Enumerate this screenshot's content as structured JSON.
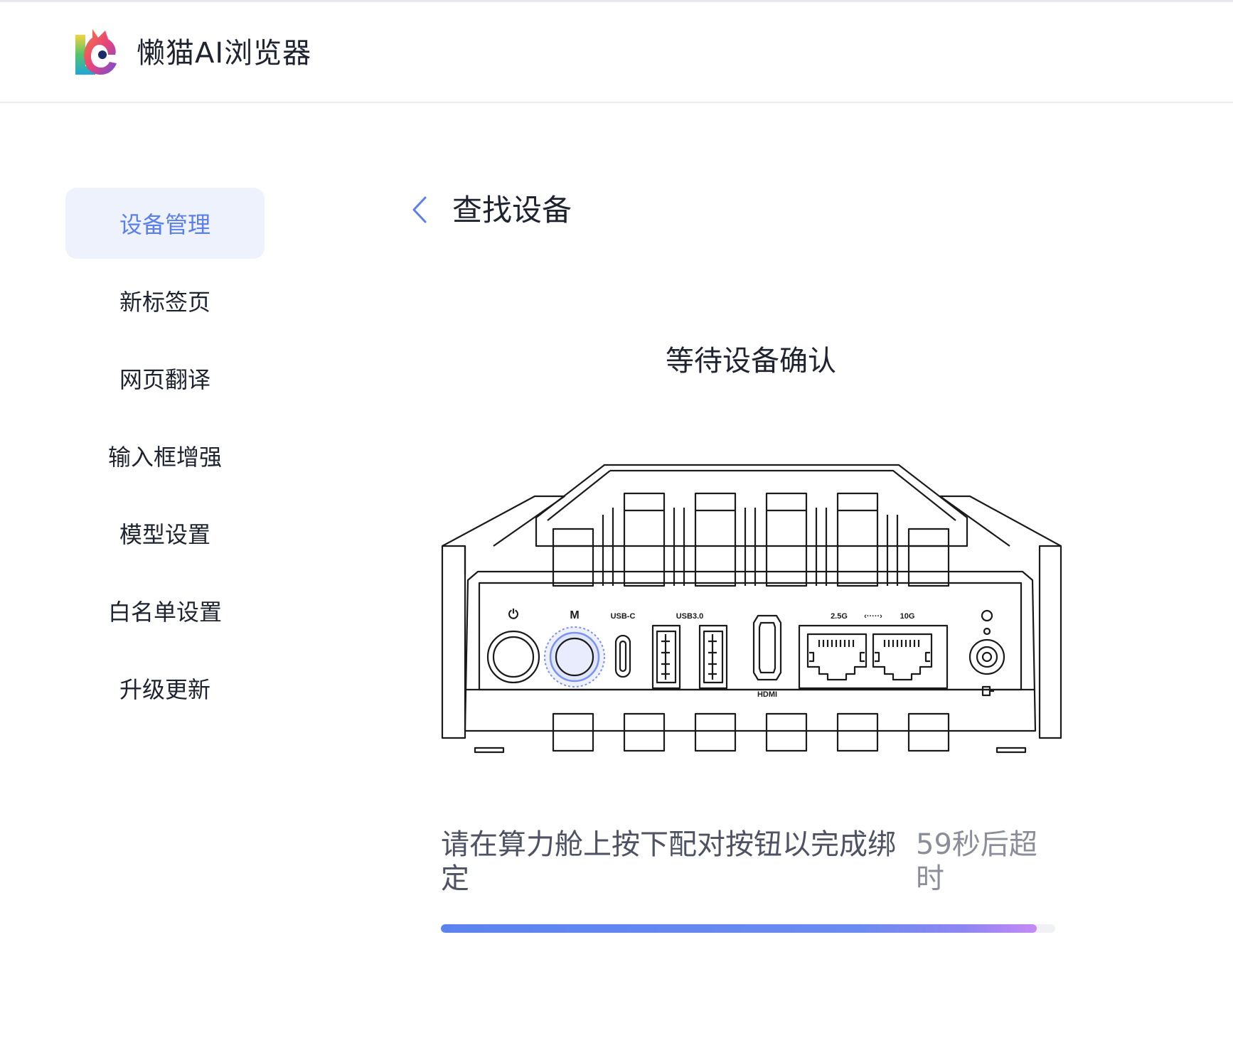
{
  "app": {
    "title": "懒猫AI浏览器",
    "logo_icon": "lazycat-logo-icon"
  },
  "sidebar": {
    "items": [
      {
        "label": "设备管理",
        "active": true
      },
      {
        "label": "新标签页",
        "active": false
      },
      {
        "label": "网页翻译",
        "active": false
      },
      {
        "label": "输入框增强",
        "active": false
      },
      {
        "label": "模型设置",
        "active": false
      },
      {
        "label": "白名单设置",
        "active": false
      },
      {
        "label": "升级更新",
        "active": false
      }
    ]
  },
  "main": {
    "back_icon": "chevron-left-icon",
    "title": "查找设备",
    "status": "等待设备确认",
    "device": {
      "port_labels": {
        "power": "⏻",
        "m": "M",
        "usbc": "USB-C",
        "usb3": "USB3.0",
        "hdmi": "HDMI",
        "lan_25g": "2.5G",
        "lan_arrow": "‹·····›",
        "lan_10g": "10G"
      }
    },
    "instruction": "请在算力舱上按下配对按钮以完成绑定",
    "timeout": "59秒后超时",
    "progress": 0.97
  },
  "colors": {
    "accent": "#5b7fec",
    "active_bg": "#eef2fd",
    "text": "#1f2330",
    "muted": "#8b8e99"
  }
}
